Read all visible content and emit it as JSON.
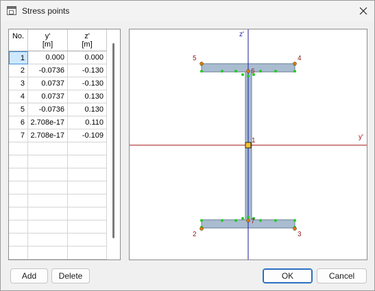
{
  "window": {
    "title": "Stress points",
    "close_icon": "close-icon"
  },
  "table": {
    "headers": [
      {
        "line1": "No.",
        "line2": ""
      },
      {
        "line1": "y'",
        "line2": "[m]"
      },
      {
        "line1": "z'",
        "line2": "[m]"
      }
    ],
    "rows": [
      {
        "no": "1",
        "y": "0.000",
        "z": "0.000"
      },
      {
        "no": "2",
        "y": "-0.0736",
        "z": "-0.130"
      },
      {
        "no": "3",
        "y": "0.0737",
        "z": "-0.130"
      },
      {
        "no": "4",
        "y": "0.0737",
        "z": "0.130"
      },
      {
        "no": "5",
        "y": "-0.0736",
        "z": "0.130"
      },
      {
        "no": "6",
        "y": "2.708e-17",
        "z": "0.110"
      },
      {
        "no": "7",
        "y": "2.708e-17",
        "z": "-0.109"
      }
    ],
    "selected_row": 1
  },
  "plot": {
    "axis_y_label": "y'",
    "axis_z_label": "z'",
    "point_labels": [
      "1",
      "2",
      "3",
      "4",
      "5",
      "6",
      "7"
    ],
    "colors": {
      "section_fill": "#a9bcd0",
      "section_stroke": "#6b7f96",
      "y_axis": "#a01010",
      "z_axis": "#1a1aa0",
      "stress_point": "#e07a00",
      "edge_point": "#22cc22",
      "label": "#8b1a1a"
    }
  },
  "buttons": {
    "add": "Add",
    "delete": "Delete",
    "ok": "OK",
    "cancel": "Cancel"
  }
}
